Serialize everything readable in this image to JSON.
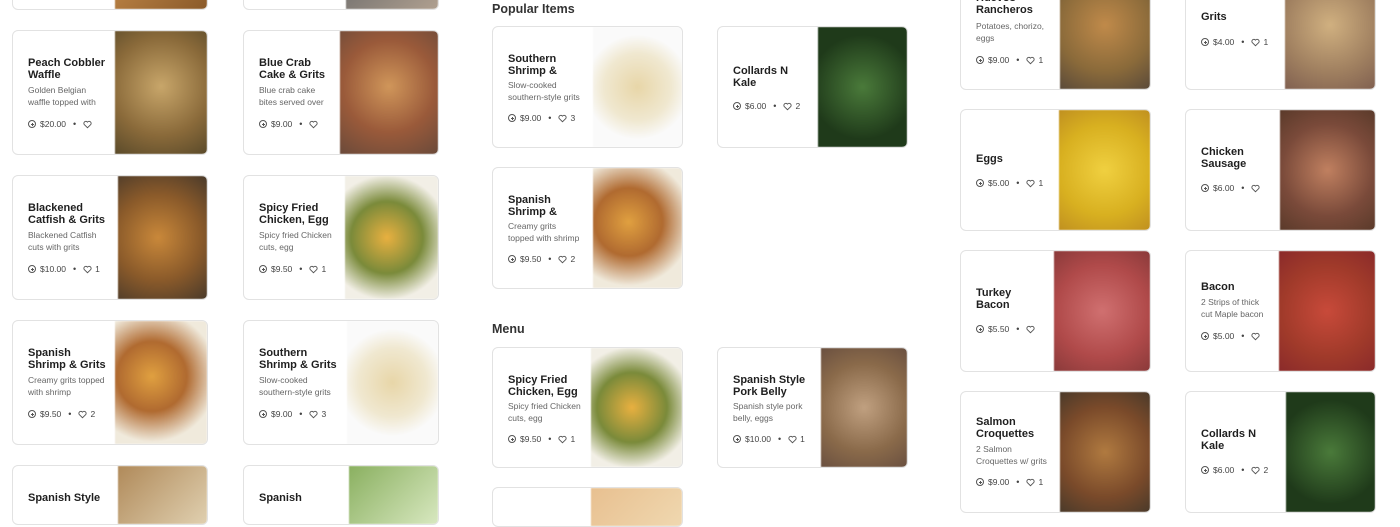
{
  "sections": {
    "popular": "Popular Items",
    "menu": "Menu"
  },
  "cards": {
    "c_peach": {
      "title": "Peach Cobbler Waffle",
      "desc": "Golden Belgian waffle topped with peach cobbler",
      "price": "$20.00",
      "likes": ""
    },
    "c_bluecrab": {
      "title": "Blue Crab Cake & Grits",
      "desc": "Blue crab cake bites served over grits",
      "price": "$9.00",
      "likes": ""
    },
    "c_catfish": {
      "title": "Blackened Catfish & Grits",
      "desc": "Blackened Catfish cuts with grits",
      "price": "$10.00",
      "likes": "1"
    },
    "c_spicy1": {
      "title": "Spicy Fried Chicken, Egg",
      "desc": "Spicy fried Chicken cuts, egg",
      "price": "$9.50",
      "likes": "1"
    },
    "c_spanish1": {
      "title": "Spanish Shrimp & Grits",
      "desc": "Creamy grits topped with shrimp",
      "price": "$9.50",
      "likes": "2"
    },
    "c_southern1": {
      "title": "Southern Shrimp & Grits",
      "desc": "Slow-cooked southern-style grits",
      "price": "$9.00",
      "likes": "3"
    },
    "c_spanishstyle_bottom": {
      "title": "Spanish Style",
      "desc": "",
      "price": "",
      "likes": ""
    },
    "c_spanish_bottom": {
      "title": "Spanish",
      "desc": "",
      "price": "",
      "likes": ""
    },
    "p_southern": {
      "title": "Southern Shrimp & Grits",
      "desc": "Slow-cooked southern-style grits",
      "price": "$9.00",
      "likes": "3"
    },
    "p_collards": {
      "title": "Collards N Kale",
      "desc": "",
      "price": "$6.00",
      "likes": "2"
    },
    "p_spanish": {
      "title": "Spanish Shrimp & Grits",
      "desc": "Creamy grits topped with shrimp",
      "price": "$9.50",
      "likes": "2"
    },
    "m_spicy": {
      "title": "Spicy Fried Chicken, Egg",
      "desc": "Spicy fried Chicken cuts, egg",
      "price": "$9.50",
      "likes": "1"
    },
    "m_porkbelly": {
      "title": "Spanish Style Pork Belly",
      "desc": "Spanish style pork belly, eggs",
      "price": "$10.00",
      "likes": "1"
    },
    "r_huevos": {
      "title": "Huevos Rancheros",
      "desc": "Potatoes, chorizo, eggs",
      "price": "$9.00",
      "likes": "1"
    },
    "r_grits": {
      "title": "Grits",
      "desc": "",
      "price": "$4.00",
      "likes": "1"
    },
    "r_eggs": {
      "title": "Eggs",
      "desc": "",
      "price": "$5.00",
      "likes": "1"
    },
    "r_sausage": {
      "title": "Chicken Sausage",
      "desc": "",
      "price": "$6.00",
      "likes": ""
    },
    "r_turkey": {
      "title": "Turkey Bacon",
      "desc": "",
      "price": "$5.50",
      "likes": ""
    },
    "r_bacon": {
      "title": "Bacon",
      "desc": "2 Strips of thick cut Maple bacon",
      "price": "$5.00",
      "likes": ""
    },
    "r_salmon": {
      "title": "Salmon Croquettes",
      "desc": "2 Salmon Croquettes w/ grits",
      "price": "$9.00",
      "likes": "1"
    },
    "r_collards": {
      "title": "Collards N Kale",
      "desc": "",
      "price": "$6.00",
      "likes": "2"
    }
  },
  "icons": {
    "add": "plus-circle-icon",
    "like": "heart-icon"
  },
  "colors": {
    "text": "#1f1f1f",
    "muted": "#666666",
    "border": "#e2e2e2"
  }
}
